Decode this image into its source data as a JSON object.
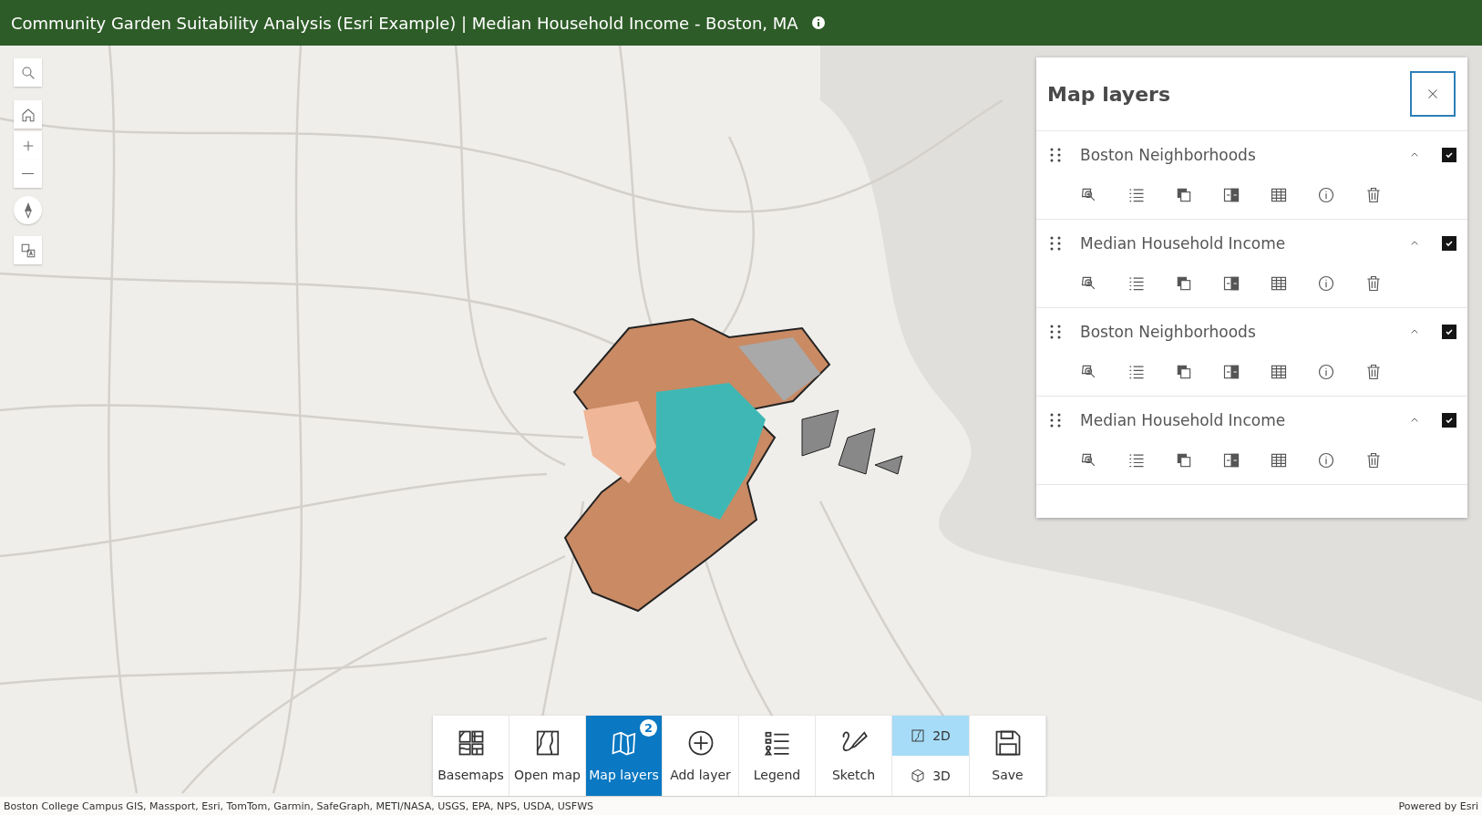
{
  "header": {
    "title": "Community Garden Suitability Analysis (Esri Example) | Median Household Income - Boston, MA"
  },
  "layers_panel": {
    "title": "Map layers",
    "layers": [
      {
        "name": "Boston Neighborhoods",
        "visible": true,
        "expanded": true
      },
      {
        "name": "Median Household Income",
        "visible": true,
        "expanded": true
      },
      {
        "name": "Boston Neighborhoods",
        "visible": true,
        "expanded": true
      },
      {
        "name": "Median Household Income",
        "visible": true,
        "expanded": true
      }
    ]
  },
  "toolbar": {
    "items": [
      {
        "kind": "button",
        "label": "Basemaps",
        "selected": false
      },
      {
        "kind": "button",
        "label": "Open map",
        "selected": false
      },
      {
        "kind": "button",
        "label": "Map layers",
        "selected": true,
        "badge": "2"
      },
      {
        "kind": "button",
        "label": "Add layer",
        "selected": false
      },
      {
        "kind": "button",
        "label": "Legend",
        "selected": false
      },
      {
        "kind": "button",
        "label": "Sketch",
        "selected": false
      },
      {
        "kind": "view-toggle",
        "options": [
          {
            "label": "2D",
            "selected": true
          },
          {
            "label": "3D",
            "selected": false
          }
        ]
      },
      {
        "kind": "button",
        "label": "Save",
        "selected": false
      }
    ]
  },
  "attribution": {
    "sources": "Boston College Campus GIS, Massport, Esri, TomTom, Garmin, SafeGraph, METI/NASA, USGS, EPA, NPS, USDA, USFWS",
    "powered_by": "Powered by Esri"
  }
}
